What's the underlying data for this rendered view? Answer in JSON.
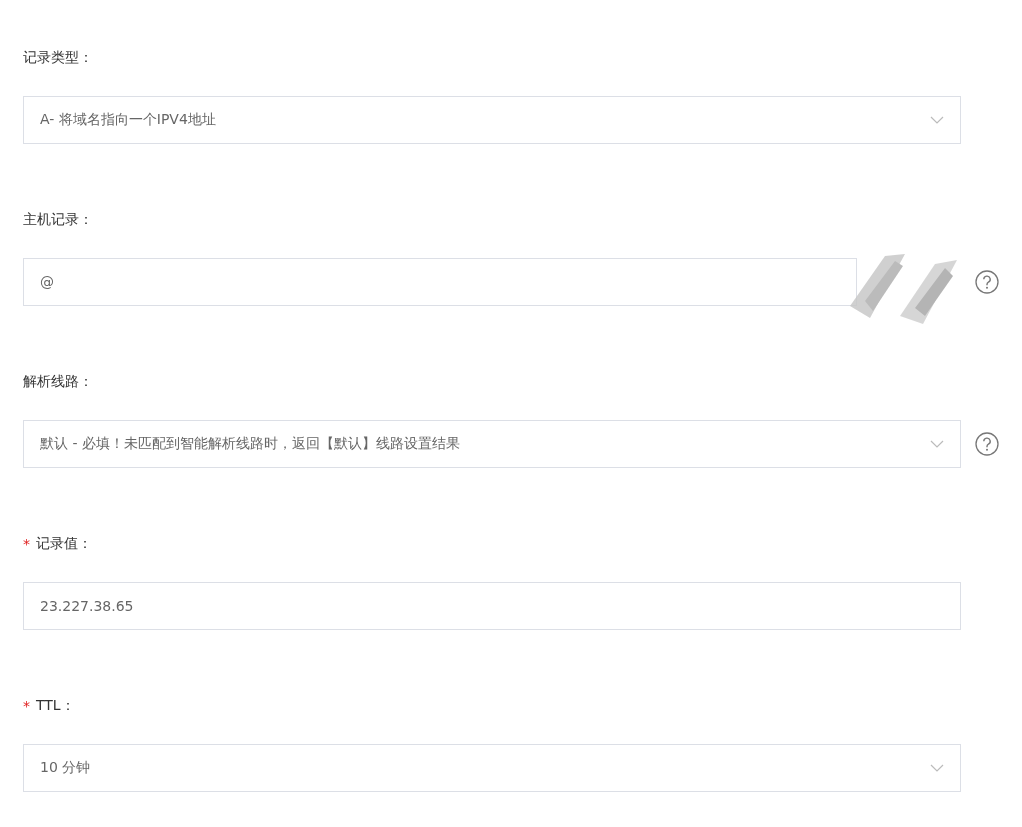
{
  "fields": [
    {
      "label": "记录类型：",
      "kind": "select",
      "value": "A- 将域名指向一个IPV4地址",
      "help": false,
      "redacted": false
    },
    {
      "label": "主机记录：",
      "kind": "input",
      "value": "@",
      "help": true,
      "redacted": true
    },
    {
      "label": "解析线路：",
      "kind": "select",
      "value": "默认 - 必填！未匹配到智能解析线路时，返回【默认】线路设置结果",
      "help": true,
      "redacted": false
    },
    {
      "required_mark": "*",
      "label": "记录值：",
      "kind": "input",
      "value": "23.227.38.65",
      "help": false,
      "redacted": false
    },
    {
      "required_mark": "*",
      "label": "TTL：",
      "kind": "select",
      "value": "10 分钟",
      "help": false,
      "redacted": false
    }
  ]
}
